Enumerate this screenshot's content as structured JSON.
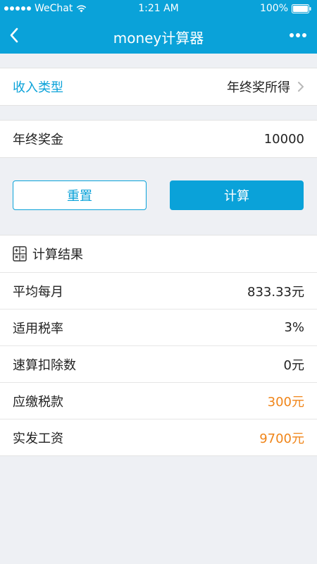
{
  "status_bar": {
    "carrier": "WeChat",
    "time": "1:21 AM",
    "battery": "100%"
  },
  "nav": {
    "title": "money计算器"
  },
  "income_type": {
    "label": "收入类型",
    "value": "年终奖所得"
  },
  "bonus": {
    "label": "年终奖金",
    "value": "10000"
  },
  "buttons": {
    "reset": "重置",
    "calculate": "计算"
  },
  "result": {
    "title": "计算结果",
    "rows": [
      {
        "label": "平均每月",
        "value": "833.33元"
      },
      {
        "label": "适用税率",
        "value": "3%"
      },
      {
        "label": "速算扣除数",
        "value": "0元"
      },
      {
        "label": "应缴税款",
        "value": "300元"
      },
      {
        "label": "实发工资",
        "value": "9700元"
      }
    ]
  },
  "colors": {
    "accent": "#0aa2d9",
    "highlight": "#f08519",
    "background": "#eef0f4"
  },
  "icons": [
    "wifi-icon",
    "battery-icon",
    "back-icon",
    "more-icon",
    "chevron-right-icon",
    "calculator-icon"
  ]
}
